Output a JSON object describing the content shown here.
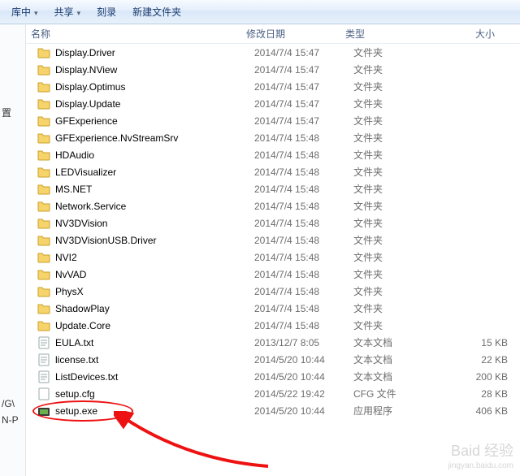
{
  "toolbar": {
    "items": [
      {
        "label": "库中",
        "dropdown": true
      },
      {
        "label": "共享",
        "dropdown": true
      },
      {
        "label": "刻录",
        "dropdown": false
      },
      {
        "label": "新建文件夹",
        "dropdown": false
      }
    ]
  },
  "leftPanel": {
    "fragments": [
      "置",
      "/G\\",
      "N-P"
    ]
  },
  "columns": {
    "name": "名称",
    "date": "修改日期",
    "type": "类型",
    "size": "大小"
  },
  "files": [
    {
      "icon": "folder",
      "name": "Display.Driver",
      "date": "2014/7/4 15:47",
      "type": "文件夹",
      "size": ""
    },
    {
      "icon": "folder",
      "name": "Display.NView",
      "date": "2014/7/4 15:47",
      "type": "文件夹",
      "size": ""
    },
    {
      "icon": "folder",
      "name": "Display.Optimus",
      "date": "2014/7/4 15:47",
      "type": "文件夹",
      "size": ""
    },
    {
      "icon": "folder",
      "name": "Display.Update",
      "date": "2014/7/4 15:47",
      "type": "文件夹",
      "size": ""
    },
    {
      "icon": "folder",
      "name": "GFExperience",
      "date": "2014/7/4 15:47",
      "type": "文件夹",
      "size": ""
    },
    {
      "icon": "folder",
      "name": "GFExperience.NvStreamSrv",
      "date": "2014/7/4 15:48",
      "type": "文件夹",
      "size": ""
    },
    {
      "icon": "folder",
      "name": "HDAudio",
      "date": "2014/7/4 15:48",
      "type": "文件夹",
      "size": ""
    },
    {
      "icon": "folder",
      "name": "LEDVisualizer",
      "date": "2014/7/4 15:48",
      "type": "文件夹",
      "size": ""
    },
    {
      "icon": "folder",
      "name": "MS.NET",
      "date": "2014/7/4 15:48",
      "type": "文件夹",
      "size": ""
    },
    {
      "icon": "folder",
      "name": "Network.Service",
      "date": "2014/7/4 15:48",
      "type": "文件夹",
      "size": ""
    },
    {
      "icon": "folder",
      "name": "NV3DVision",
      "date": "2014/7/4 15:48",
      "type": "文件夹",
      "size": ""
    },
    {
      "icon": "folder",
      "name": "NV3DVisionUSB.Driver",
      "date": "2014/7/4 15:48",
      "type": "文件夹",
      "size": ""
    },
    {
      "icon": "folder",
      "name": "NVI2",
      "date": "2014/7/4 15:48",
      "type": "文件夹",
      "size": ""
    },
    {
      "icon": "folder",
      "name": "NvVAD",
      "date": "2014/7/4 15:48",
      "type": "文件夹",
      "size": ""
    },
    {
      "icon": "folder",
      "name": "PhysX",
      "date": "2014/7/4 15:48",
      "type": "文件夹",
      "size": ""
    },
    {
      "icon": "folder",
      "name": "ShadowPlay",
      "date": "2014/7/4 15:48",
      "type": "文件夹",
      "size": ""
    },
    {
      "icon": "folder",
      "name": "Update.Core",
      "date": "2014/7/4 15:48",
      "type": "文件夹",
      "size": ""
    },
    {
      "icon": "text",
      "name": "EULA.txt",
      "date": "2013/12/7 8:05",
      "type": "文本文档",
      "size": "15 KB"
    },
    {
      "icon": "text",
      "name": "license.txt",
      "date": "2014/5/20 10:44",
      "type": "文本文档",
      "size": "22 KB"
    },
    {
      "icon": "text",
      "name": "ListDevices.txt",
      "date": "2014/5/20 10:44",
      "type": "文本文档",
      "size": "200 KB"
    },
    {
      "icon": "cfg",
      "name": "setup.cfg",
      "date": "2014/5/22 19:42",
      "type": "CFG 文件",
      "size": "28 KB"
    },
    {
      "icon": "exe",
      "name": "setup.exe",
      "date": "2014/5/20 10:44",
      "type": "应用程序",
      "size": "406 KB",
      "highlight": true
    }
  ],
  "watermark": {
    "line1": "Baid 经验",
    "line2": "jingyan.baidu.com"
  }
}
